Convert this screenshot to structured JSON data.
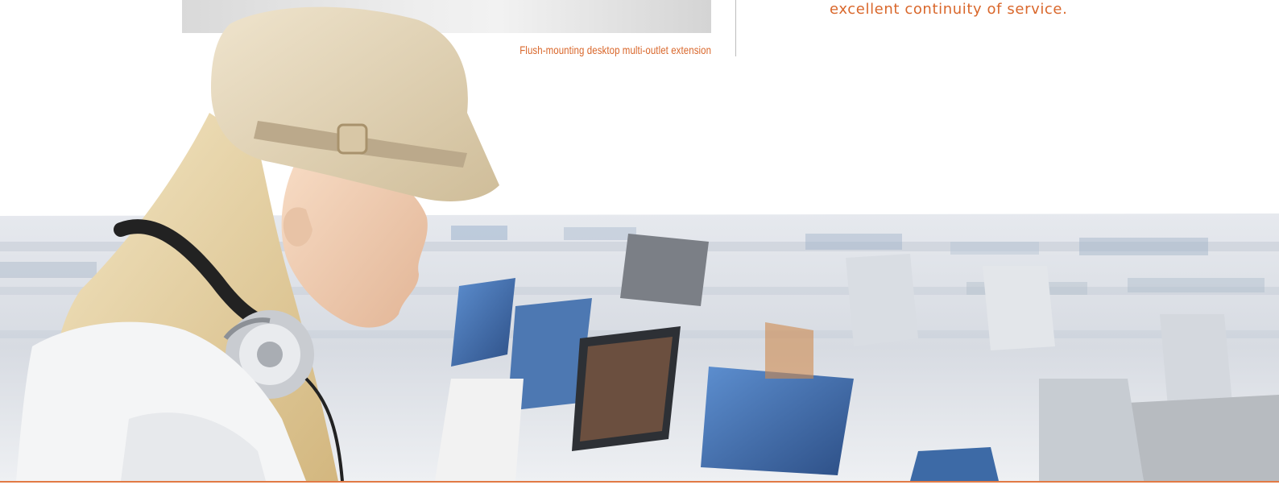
{
  "caption": "Flush-mounting desktop multi-outlet extension",
  "body_text_fragment": "excellent continuity of service.",
  "colors": {
    "accent": "#d9672b",
    "rule": "#bdbdbd",
    "bottom_rule": "#e27a45"
  }
}
